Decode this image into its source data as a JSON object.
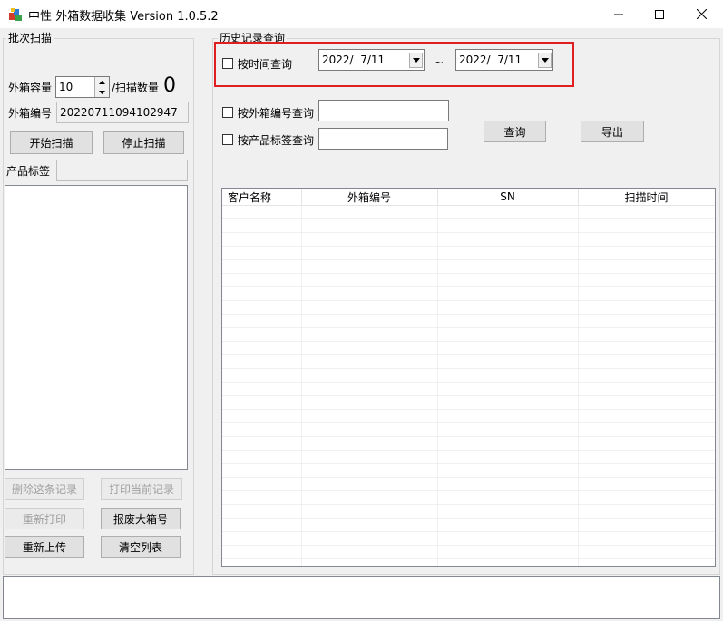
{
  "window": {
    "title": "中性 外箱数据收集 Version 1.0.5.2",
    "minimize_symbol": "—",
    "maximize_symbol": "☐",
    "close_symbol": "✕"
  },
  "batch": {
    "group_title": "批次扫描",
    "capacity_label": "外箱容量",
    "capacity_value": "10",
    "scan_count_label": "/扫描数量",
    "scan_count_value": "0",
    "box_no_label": "外箱编号",
    "box_no_value": "20220711094102947",
    "start_button": "开始扫描",
    "stop_button": "停止扫描",
    "product_label": "产品标签",
    "product_value": "",
    "delete_button": "删除这条记录",
    "print_current_button": "打印当前记录",
    "reprint_button": "重新打印",
    "scrap_button": "报废大箱号",
    "reupload_button": "重新上传",
    "clear_button": "清空列表"
  },
  "history": {
    "group_title": "历史记录查询",
    "by_time_label": "按时间查询",
    "date_from": "2022/  7/11",
    "date_to": "2022/  7/11",
    "tilde": "~",
    "by_box_label": "按外箱编号查询",
    "by_box_value": "",
    "by_product_label": "按产品标签查询",
    "by_product_value": "",
    "query_button": "查询",
    "export_button": "导出",
    "columns": [
      "客户名称",
      "外箱编号",
      "SN",
      "扫描时间"
    ]
  },
  "status": {
    "text": ""
  }
}
